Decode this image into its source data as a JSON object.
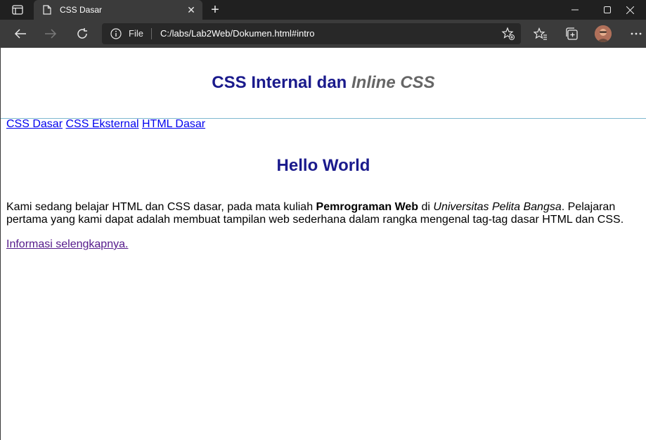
{
  "browser": {
    "tab_title": "CSS Dasar",
    "address_label": "File",
    "address_url": "C:/labs/Lab2Web/Dokumen.html#intro"
  },
  "page": {
    "header_main": "CSS Internal dan ",
    "header_italic": "Inline CSS",
    "nav": [
      "CSS Dasar",
      "CSS Eksternal",
      "HTML Dasar"
    ],
    "heading": "Hello World",
    "paragraph": {
      "part1": "Kami sedang belajar HTML dan CSS dasar, pada mata kuliah ",
      "bold": "Pemrograman Web",
      "part2": " di ",
      "italic": "Universitas Pelita Bangsa",
      "part3": ". Pelajaran pertama yang kami dapat adalah membuat tampilan web sederhana dalam rangka mengenal tag-tag dasar HTML dan CSS."
    },
    "more_link": "Informasi selengkapnya."
  },
  "colors": {
    "heading": "#1a1a8c",
    "link": "#0000ee",
    "visited_link": "#551a8b",
    "header_border": "#7fb8cf"
  }
}
